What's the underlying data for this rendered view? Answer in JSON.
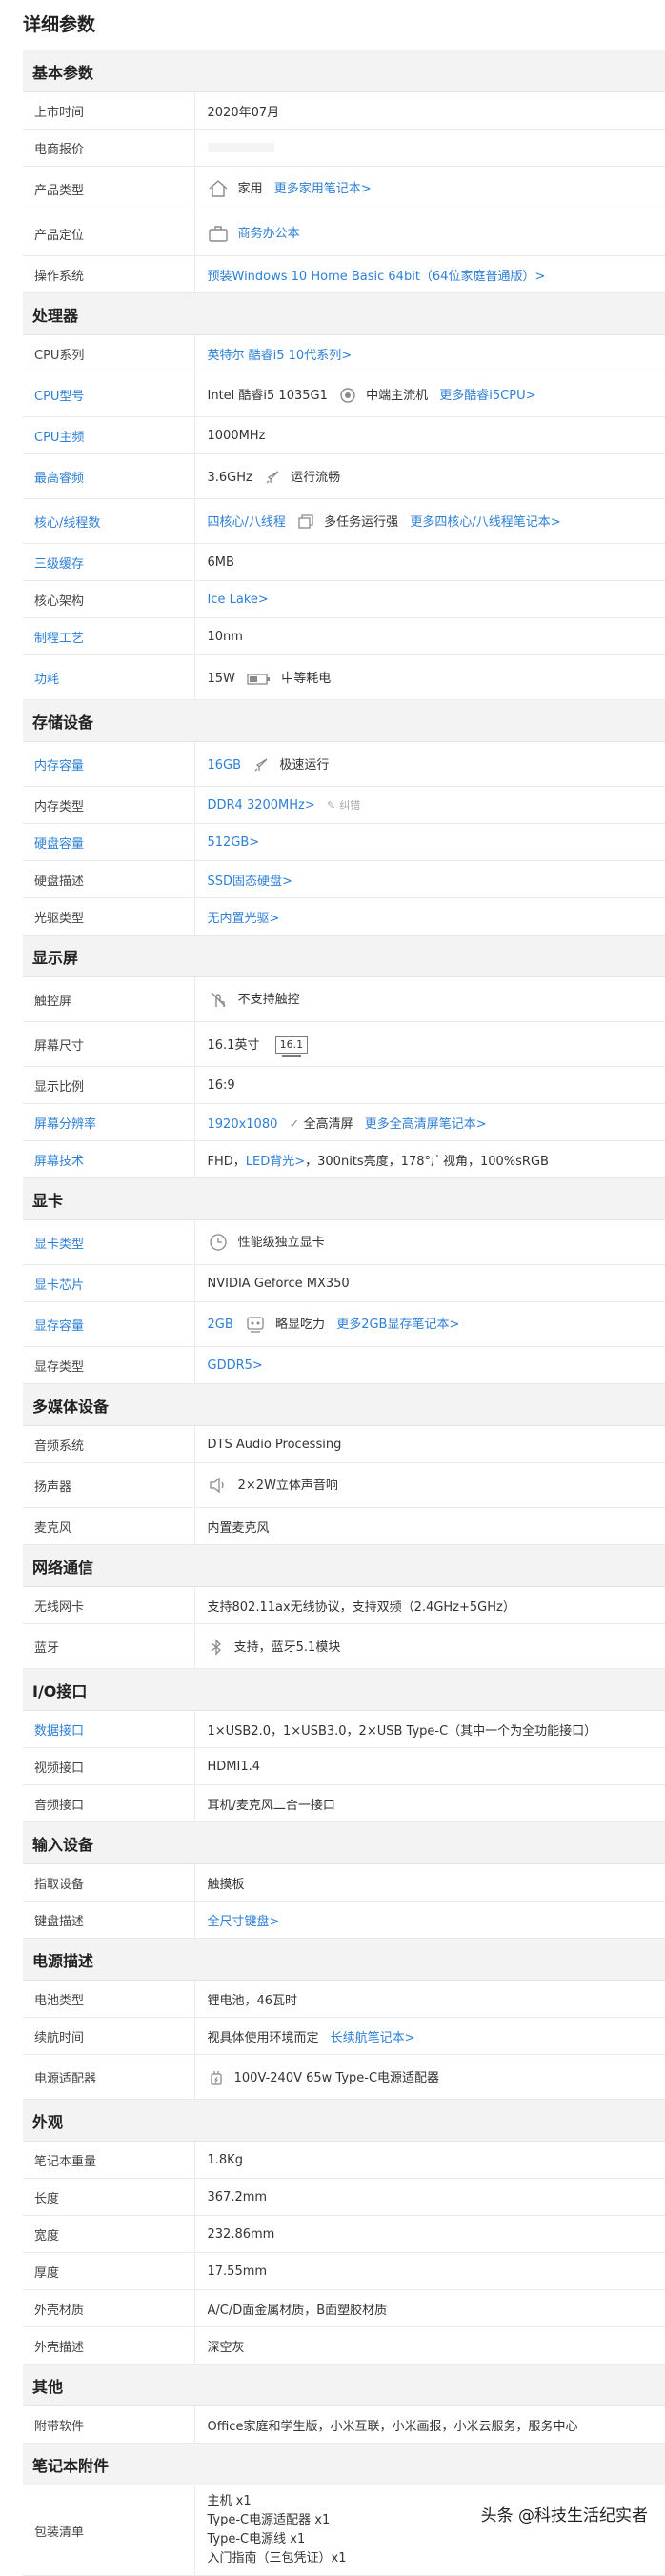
{
  "title": "详细参数",
  "basic": {
    "section": "基本参数",
    "launch_label": "上市时间",
    "launch": "2020年07月",
    "price_label": "电商报价",
    "type_label": "产品类型",
    "type": "家用",
    "type_link": "更多家用笔记本>",
    "position_label": "产品定位",
    "position": "商务办公本",
    "os_label": "操作系统",
    "os": "预装Windows 10 Home Basic 64bit（64位家庭普通版）>"
  },
  "cpu": {
    "section": "处理器",
    "series_label": "CPU系列",
    "series": "英特尔 酷睿i5 10代系列>",
    "model_label": "CPU型号",
    "model": "Intel 酷睿i5 1035G1",
    "model_tier": "中端主流机",
    "model_link": "更多酷睿i5CPU>",
    "freq_label": "CPU主频",
    "freq": "1000MHz",
    "turbo_label": "最高睿频",
    "turbo": "3.6GHz",
    "turbo_note": "运行流畅",
    "cores_label": "核心/线程数",
    "cores": "四核心/八线程",
    "cores_note": "多任务运行强",
    "cores_link": "更多四核心/八线程笔记本>",
    "l3_label": "三级缓存",
    "l3": "6MB",
    "arch_label": "核心架构",
    "arch": "Ice Lake>",
    "process_label": "制程工艺",
    "process": "10nm",
    "tdp_label": "功耗",
    "tdp": "15W",
    "tdp_note": "中等耗电"
  },
  "storage": {
    "section": "存储设备",
    "ram_label": "内存容量",
    "ram": "16GB",
    "ram_note": "极速运行",
    "ramtype_label": "内存类型",
    "ramtype": "DDR4 3200MHz>",
    "ramtype_fix": "纠错",
    "disk_label": "硬盘容量",
    "disk": "512GB>",
    "diskdesc_label": "硬盘描述",
    "diskdesc": "SSD固态硬盘>",
    "optical_label": "光驱类型",
    "optical": "无内置光驱>"
  },
  "display": {
    "section": "显示屏",
    "touch_label": "触控屏",
    "touch": "不支持触控",
    "size_label": "屏幕尺寸",
    "size": "16.1英寸",
    "size_badge": "16.1",
    "ratio_label": "显示比例",
    "ratio": "16:9",
    "res_label": "屏幕分辨率",
    "res": "1920x1080",
    "res_note": "全高清屏",
    "res_link": "更多全高清屏笔记本>",
    "tech_label": "屏幕技术",
    "tech_pre": "FHD，",
    "tech_link": "LED背光>",
    "tech_post": "，300nits亮度，178°广视角，100%sRGB"
  },
  "gpu": {
    "section": "显卡",
    "type_label": "显卡类型",
    "type": "性能级独立显卡",
    "chip_label": "显卡芯片",
    "chip": "NVIDIA Geforce MX350",
    "vram_label": "显存容量",
    "vram": "2GB",
    "vram_note": "略显吃力",
    "vram_link": "更多2GB显存笔记本>",
    "vramtype_label": "显存类型",
    "vramtype": "GDDR5>"
  },
  "media": {
    "section": "多媒体设备",
    "audio_label": "音频系统",
    "audio": "DTS Audio Processing",
    "speaker_label": "扬声器",
    "speaker": "2×2W立体声音响",
    "mic_label": "麦克风",
    "mic": "内置麦克风"
  },
  "network": {
    "section": "网络通信",
    "wifi_label": "无线网卡",
    "wifi": "支持802.11ax无线协议，支持双频（2.4GHz+5GHz）",
    "bt_label": "蓝牙",
    "bt": "支持，蓝牙5.1模块"
  },
  "io": {
    "section": "I/O接口",
    "data_label": "数据接口",
    "data": "1×USB2.0，1×USB3.0，2×USB Type-C（其中一个为全功能接口）",
    "video_label": "视频接口",
    "video": "HDMI1.4",
    "audio_label": "音频接口",
    "audio": "耳机/麦克风二合一接口"
  },
  "input": {
    "section": "输入设备",
    "pointer_label": "指取设备",
    "pointer": "触摸板",
    "kb_label": "键盘描述",
    "kb": "全尺寸键盘>"
  },
  "power": {
    "section": "电源描述",
    "battery_label": "电池类型",
    "battery": "锂电池，46瓦时",
    "life_label": "续航时间",
    "life": "视具体使用环境而定",
    "life_link": "长续航笔记本>",
    "adapter_label": "电源适配器",
    "adapter": "100V-240V 65w Type-C电源适配器"
  },
  "exterior": {
    "section": "外观",
    "weight_label": "笔记本重量",
    "weight": "1.8Kg",
    "length_label": "长度",
    "length": "367.2mm",
    "width_label": "宽度",
    "width": "232.86mm",
    "thick_label": "厚度",
    "thick": "17.55mm",
    "material_label": "外壳材质",
    "material": "A/C/D面金属材质，B面塑胶材质",
    "color_label": "外壳描述",
    "color": "深空灰"
  },
  "other": {
    "section": "其他",
    "software_label": "附带软件",
    "software": "Office家庭和学生版，小米互联，小米画报，小米云服务，服务中心"
  },
  "accessories": {
    "section": "笔记本附件",
    "pack_label": "包装清单",
    "pack": [
      "主机 x1",
      "Type-C电源适配器 x1",
      "Type-C电源线 x1",
      "入门指南（三包凭证）x1"
    ]
  },
  "watermark": "头条 @科技生活纪实者",
  "colors": {
    "link": "#2d7fd6",
    "section_bg": "#f3f3f3",
    "border": "#ebebeb"
  },
  "icons": [
    "house-icon",
    "briefcase-icon",
    "cpu-badge-icon",
    "rocket-icon",
    "multitask-icon",
    "battery-icon",
    "touch-icon",
    "gpu-icon",
    "vram-icon",
    "speaker-icon",
    "bluetooth-icon",
    "adapter-icon"
  ]
}
